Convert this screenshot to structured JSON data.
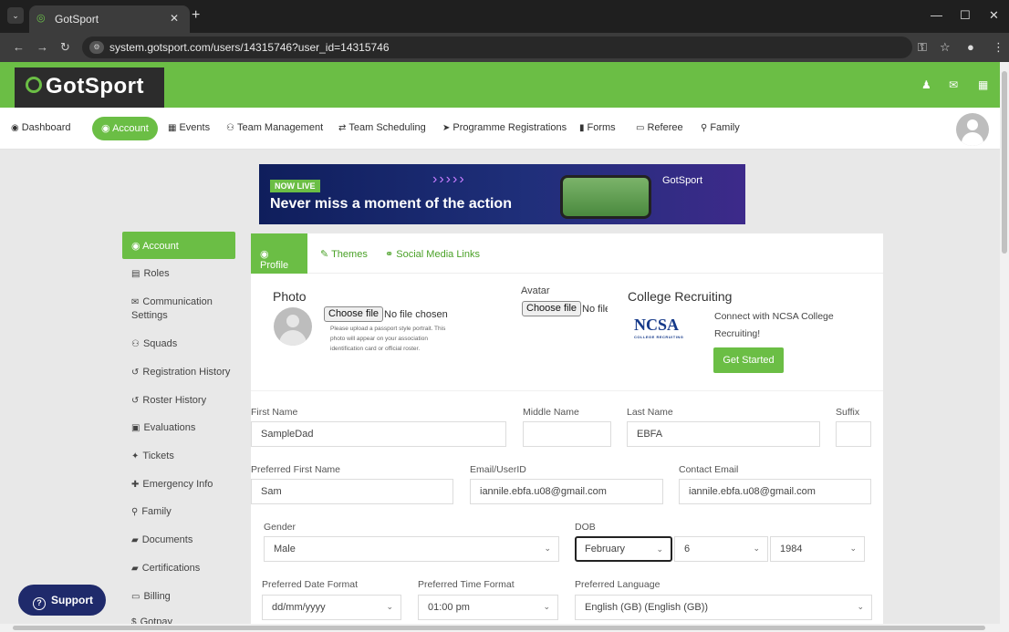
{
  "browser": {
    "tab_title": "GotSport",
    "url": "system.gotsport.com/users/14315746?user_id=14315746"
  },
  "header": {
    "logo_text": "GotSport"
  },
  "nav": {
    "items": [
      "Dashboard",
      "Account",
      "Events",
      "Team Management",
      "Team Scheduling",
      "Programme Registrations",
      "Forms",
      "Referee",
      "Family"
    ],
    "active": "Account"
  },
  "banner": {
    "badge": "NOW LIVE",
    "headline": "Never miss a moment of the action",
    "brand": "GotSport"
  },
  "sidebar": {
    "items": [
      "Account",
      "Roles",
      "Communication Settings",
      "Squads",
      "Registration History",
      "Roster History",
      "Evaluations",
      "Tickets",
      "Emergency Info",
      "Family",
      "Documents",
      "Certifications",
      "Billing",
      "Gotpay"
    ]
  },
  "support": {
    "label": "Support"
  },
  "subtabs": [
    "Profile",
    "Themes",
    "Social Media Links"
  ],
  "photo": {
    "label": "Photo",
    "button": "Choose file",
    "status": "No file chosen",
    "note": "Please upload a passport style portrait. This photo will appear on your association identification card or official roster."
  },
  "avatar": {
    "label": "Avatar",
    "button": "Choose file",
    "status": "No file chosen"
  },
  "college": {
    "title": "College Recruiting",
    "logo": "NCSA",
    "logo_sub": "COLLEGE RECRUITING",
    "description": "Connect with NCSA College Recruiting!",
    "button": "Get Started"
  },
  "form": {
    "first_name": {
      "label": "First Name",
      "value": "SampleDad"
    },
    "middle_name": {
      "label": "Middle Name",
      "value": ""
    },
    "last_name": {
      "label": "Last Name",
      "value": "EBFA"
    },
    "suffix": {
      "label": "Suffix",
      "value": ""
    },
    "preferred_first_name": {
      "label": "Preferred First Name",
      "value": "Sam"
    },
    "email": {
      "label": "Email/UserID",
      "value": "iannile.ebfa.u08@gmail.com"
    },
    "contact_email": {
      "label": "Contact Email",
      "value": "iannile.ebfa.u08@gmail.com"
    },
    "gender": {
      "label": "Gender",
      "value": "Male"
    },
    "dob": {
      "label": "DOB",
      "month": "February",
      "day": "6",
      "year": "1984"
    },
    "date_format": {
      "label": "Preferred Date Format",
      "value": "dd/mm/yyyy"
    },
    "time_format": {
      "label": "Preferred Time Format",
      "value": "01:00 pm"
    },
    "language": {
      "label": "Preferred Language",
      "value": "English (GB) (English (GB))"
    }
  },
  "colors": {
    "brand_green": "#6bbe45",
    "support_navy": "#1f2a6b"
  }
}
